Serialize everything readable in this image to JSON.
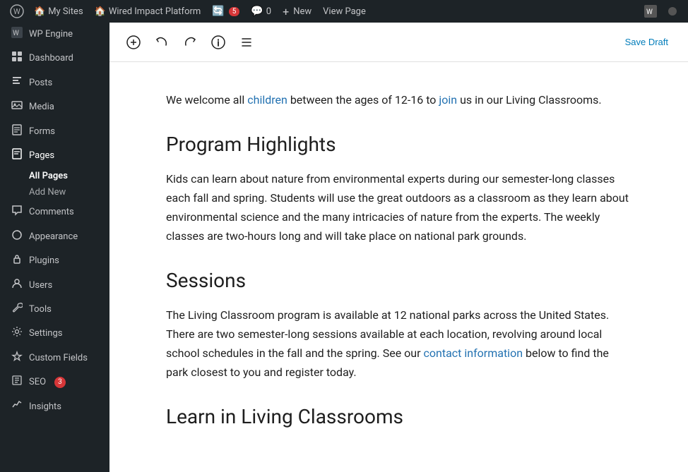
{
  "adminbar": {
    "wp_logo": "⚙",
    "items": [
      {
        "id": "my-sites",
        "label": "My Sites",
        "icon": "🏠"
      },
      {
        "id": "wired-impact",
        "label": "Wired Impact Platform",
        "icon": "🏠"
      },
      {
        "id": "updates",
        "label": "5",
        "icon": "🔄"
      },
      {
        "id": "comments",
        "label": "0",
        "icon": "💬"
      },
      {
        "id": "new",
        "label": "New",
        "icon": "+"
      },
      {
        "id": "view-page",
        "label": "View Page",
        "icon": ""
      }
    ]
  },
  "sidebar": {
    "items": [
      {
        "id": "wp-engine",
        "label": "WP Engine",
        "icon": "⚙"
      },
      {
        "id": "dashboard",
        "label": "Dashboard",
        "icon": "⊞"
      },
      {
        "id": "posts",
        "label": "Posts",
        "icon": "📌"
      },
      {
        "id": "media",
        "label": "Media",
        "icon": "🖼"
      },
      {
        "id": "forms",
        "label": "Forms",
        "icon": "📋"
      },
      {
        "id": "pages",
        "label": "Pages",
        "icon": "📄",
        "active": true
      },
      {
        "id": "comments",
        "label": "Comments",
        "icon": "💬"
      },
      {
        "id": "appearance",
        "label": "Appearance",
        "icon": "🎨"
      },
      {
        "id": "plugins",
        "label": "Plugins",
        "icon": "🔌"
      },
      {
        "id": "users",
        "label": "Users",
        "icon": "👤"
      },
      {
        "id": "tools",
        "label": "Tools",
        "icon": "🔧"
      },
      {
        "id": "settings",
        "label": "Settings",
        "icon": "⚙"
      },
      {
        "id": "custom-fields",
        "label": "Custom Fields",
        "icon": "✦"
      },
      {
        "id": "seo",
        "label": "SEO",
        "icon": "📊",
        "badge": "3"
      },
      {
        "id": "insights",
        "label": "Insights",
        "icon": "📈"
      }
    ],
    "pages_sub": [
      {
        "id": "all-pages",
        "label": "All Pages",
        "active": true
      },
      {
        "id": "add-new",
        "label": "Add New"
      }
    ]
  },
  "toolbar": {
    "add_block": "+",
    "undo": "↩",
    "redo": "↪",
    "info": "ℹ",
    "list_view": "☰",
    "save_draft": "Save Draft"
  },
  "editor": {
    "content": [
      {
        "type": "paragraph",
        "text": "We welcome all children between the ages of 12-16 to join us in our Living Classrooms.",
        "links": [
          "children",
          "join"
        ]
      },
      {
        "type": "h2",
        "text": "Program Highlights"
      },
      {
        "type": "paragraph",
        "text": "Kids can learn about nature from environmental experts during our semester-long classes each fall and spring. Students will use the great outdoors as a classroom as they learn about environmental science and the many intricacies of nature from the experts. The weekly classes are two-hours long and will take place on national park grounds."
      },
      {
        "type": "h2",
        "text": "Sessions"
      },
      {
        "type": "paragraph",
        "text": "The Living Classroom program is available at 12 national parks across the United States. There are two semester-long sessions available at each location, revolving around local school schedules in the fall and the spring. See our contact information below to find the park closest to you and register today.",
        "link_text": "contact information"
      },
      {
        "type": "h2",
        "text": "Learn in Living Classrooms"
      }
    ]
  }
}
